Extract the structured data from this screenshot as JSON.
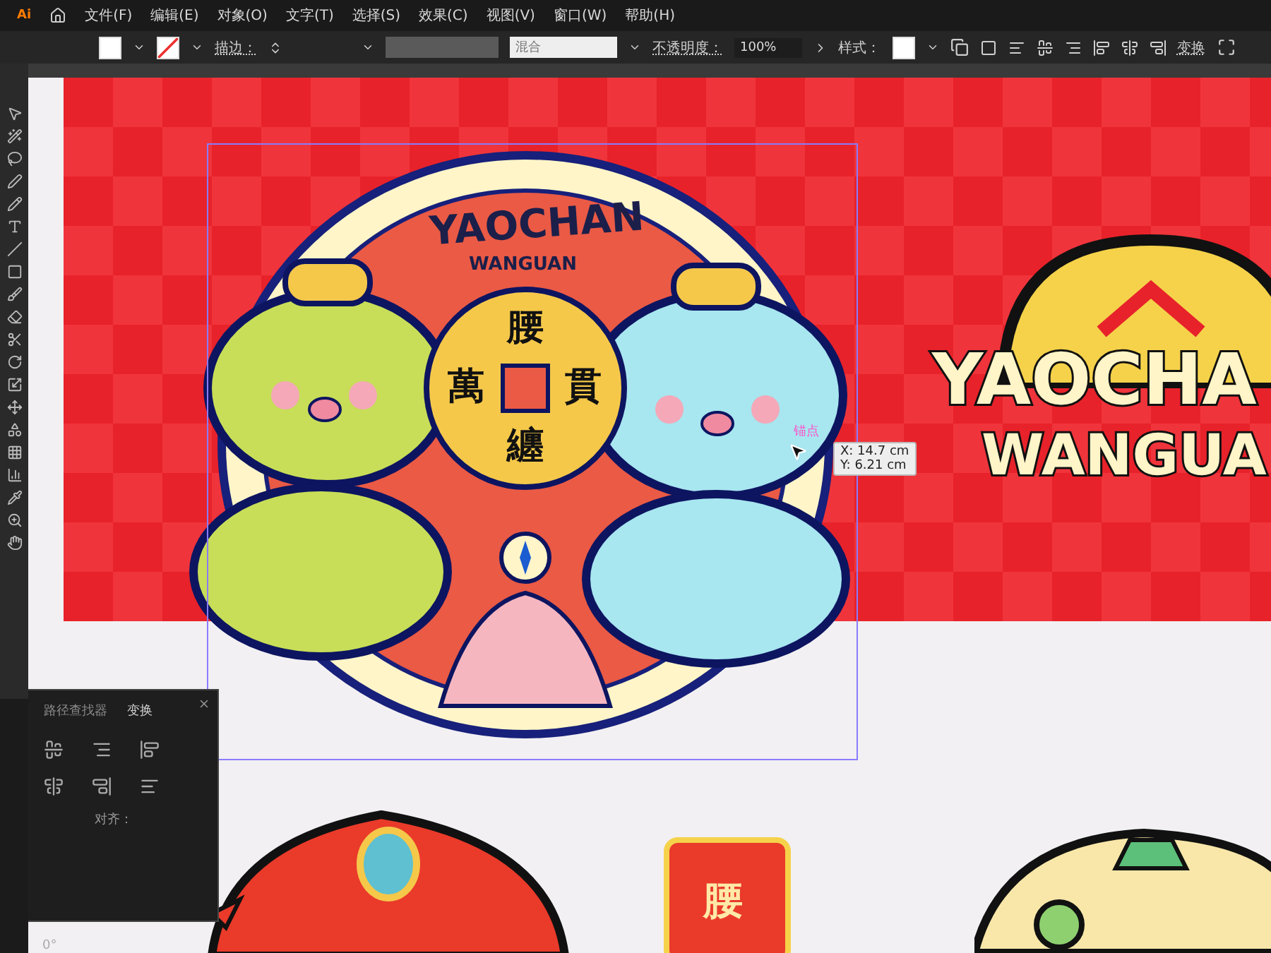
{
  "app": {
    "logo": "Ai"
  },
  "menu": [
    "文件(F)",
    "编辑(E)",
    "对象(O)",
    "文字(T)",
    "选择(S)",
    "效果(C)",
    "视图(V)",
    "窗口(W)",
    "帮助(H)"
  ],
  "control_bar": {
    "stroke_label": "描边：",
    "blend_placeholder": "混合",
    "opacity_label": "不透明度：",
    "opacity_value": "100%",
    "style_label": "样式：",
    "transform_label": "变换"
  },
  "badge": {
    "title": "YAOCHAN",
    "subtitle": "WANGUAN",
    "coin_chars": [
      "腰",
      "萬",
      "貫",
      "纏"
    ]
  },
  "hover": {
    "anchor_label": "锚点",
    "x": "X: 14.7 cm",
    "y": "Y: 6.21 cm"
  },
  "logo": {
    "line1": "YAOCHA",
    "line2": "WANGUA"
  },
  "tile": {
    "char": "腰"
  },
  "panel": {
    "tabs": [
      {
        "label": "路径查找器",
        "selected": false
      },
      {
        "label": "变换",
        "selected": true
      }
    ],
    "align_label": "对齐："
  },
  "status": {
    "angle": "0°"
  }
}
